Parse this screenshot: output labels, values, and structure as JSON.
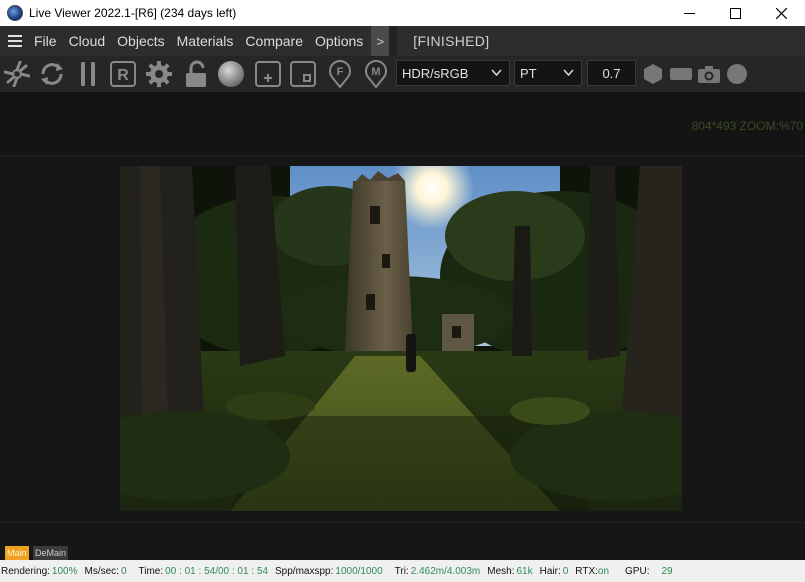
{
  "window": {
    "title": "Live Viewer 2022.1-[R6] (234 days left)"
  },
  "menu": {
    "items": [
      "File",
      "Cloud",
      "Objects",
      "Materials",
      "Compare",
      "Options"
    ],
    "more_label": ">",
    "render_status": "[FINISHED]"
  },
  "toolbar": {
    "icons": [
      "aperture-icon",
      "refresh-icon",
      "pause-icon",
      "region-render-icon",
      "settings-gear-icon",
      "unlock-icon",
      "material-sphere-icon",
      "add-object-icon",
      "object-icon",
      "f-marker-icon",
      "m-marker-icon"
    ],
    "color_space": {
      "selected": "HDR/sRGB"
    },
    "render_mode": {
      "selected": "PT"
    },
    "exposure_value": "0.7",
    "right_icons": [
      "hexagon-icon",
      "rectangle-icon",
      "camera-icon",
      "circle-icon"
    ]
  },
  "viewport": {
    "resolution_info": "804*493 ZOOM:%70"
  },
  "tabs": {
    "main": "Main",
    "demain": "DeMain"
  },
  "status": {
    "rendering_label": "Rendering:",
    "rendering_value": "100%",
    "mssec_label": "Ms/sec:",
    "mssec_value": "0",
    "time_label": "Time:",
    "time_value": "00 : 01 : 54/00 : 01 : 54",
    "spp_label": "Spp/maxspp:",
    "spp_value": "1000/1000",
    "tri_label": "Tri:",
    "tri_value": "2.462m/4.003m",
    "mesh_label": "Mesh:",
    "mesh_value": "61k",
    "hair_label": "Hair:",
    "hair_value": "0",
    "rtx_label": "RTX:",
    "rtx_value": "on",
    "gpu_label": "GPU:",
    "gpu_value": "29"
  },
  "colors": {
    "accent_tab": "#f0a020",
    "status_value": "#2e8b57"
  }
}
